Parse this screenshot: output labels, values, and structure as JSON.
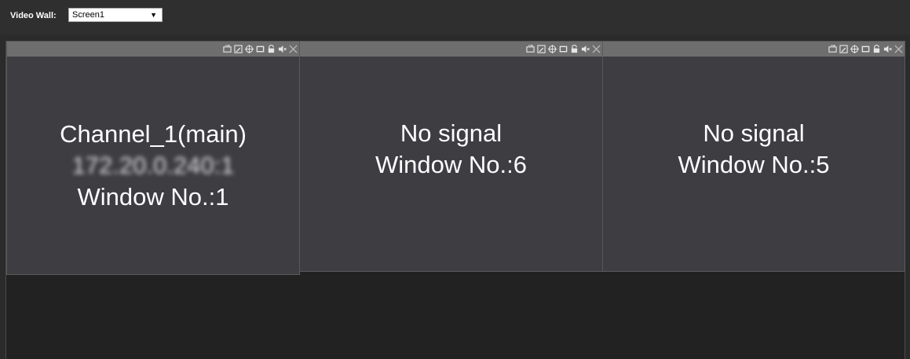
{
  "header": {
    "video_wall_label": "Video Wall:",
    "screen_select_value": "Screen1"
  },
  "windows": [
    {
      "lines": [
        "Channel_1(main)",
        "172.20.0.240:1",
        "Window No.:1"
      ],
      "blurred_line_index": 1
    },
    {
      "lines": [
        "No signal",
        "Window No.:6"
      ]
    },
    {
      "lines": [
        "No signal",
        "Window No.:5"
      ]
    }
  ],
  "toolbar_icons": [
    "swap-icon",
    "edit-icon",
    "move-icon",
    "maximize-icon",
    "lock-icon",
    "mute-icon",
    "close-icon"
  ],
  "colors": {
    "window_bg": "#3d3d42",
    "titlebar_bg": "#6e6e6e",
    "wall_bg": "#222222"
  }
}
